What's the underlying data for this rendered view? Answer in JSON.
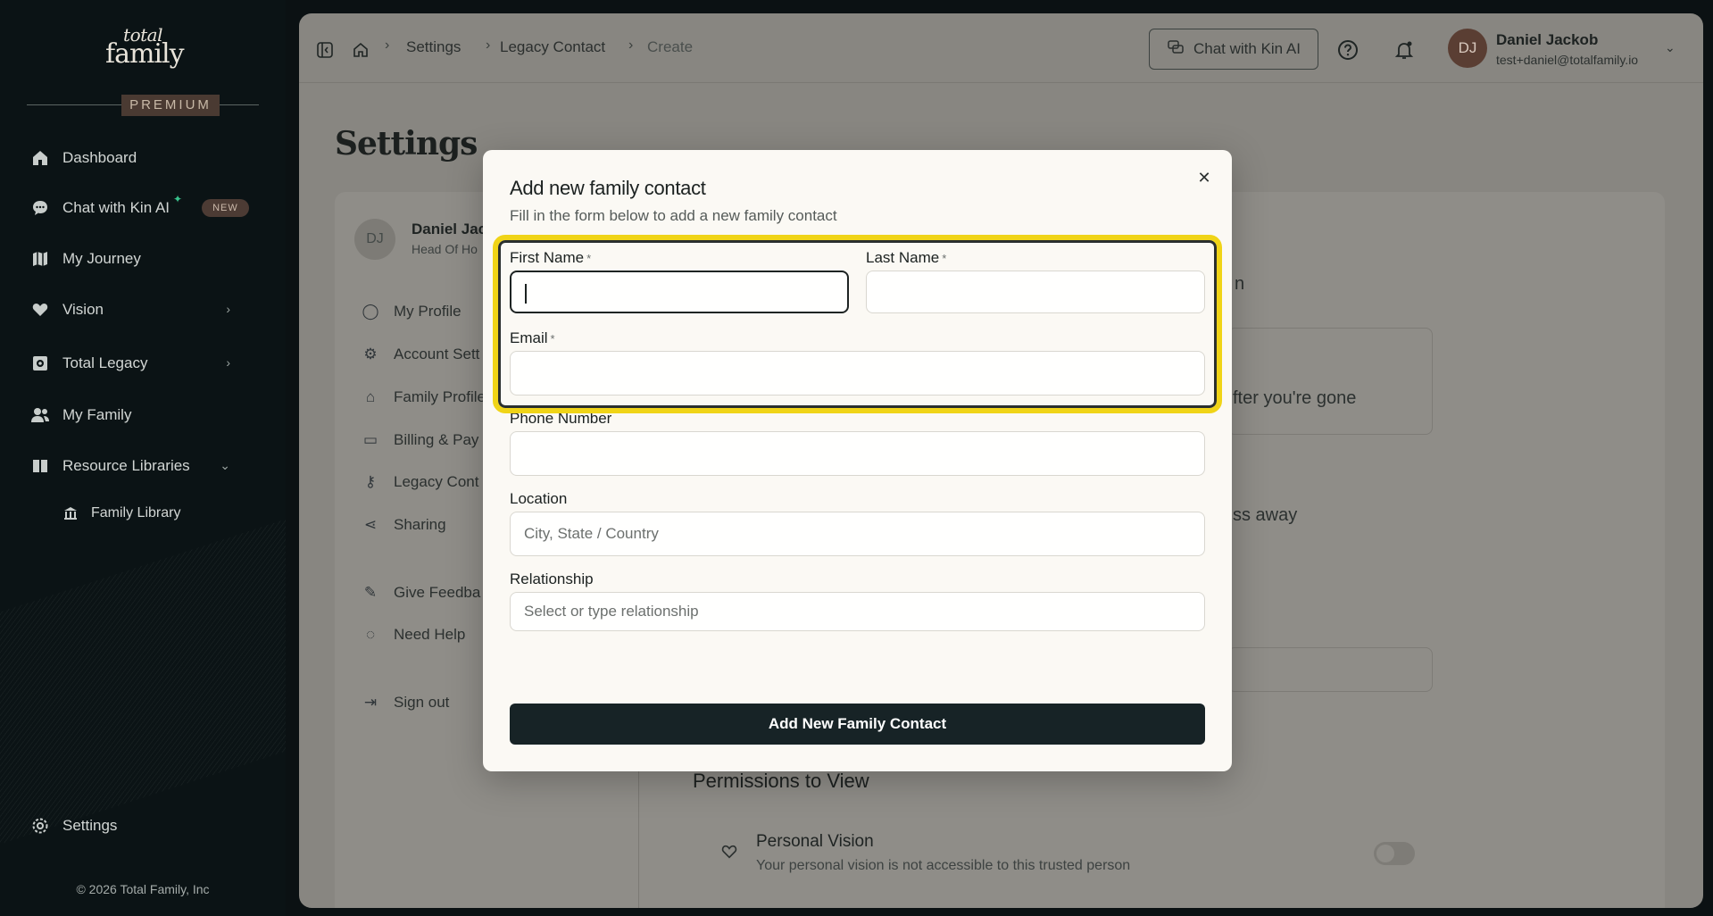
{
  "sidebar": {
    "logo_top": "total",
    "logo_bottom": "family",
    "tier": "PREMIUM",
    "items": [
      {
        "label": "Dashboard",
        "icon": "home-icon"
      },
      {
        "label": "Chat with Kin AI",
        "icon": "chat-icon",
        "badge": "NEW"
      },
      {
        "label": "My Journey",
        "icon": "map-icon"
      },
      {
        "label": "Vision",
        "icon": "heart-icon"
      },
      {
        "label": "Total Legacy",
        "icon": "vault-icon"
      },
      {
        "label": "My Family",
        "icon": "people-icon"
      },
      {
        "label": "Resource Libraries",
        "icon": "book-icon"
      },
      {
        "label": "Family Library",
        "icon": "library-icon"
      }
    ],
    "settings_label": "Settings",
    "copyright": "© 2026 Total Family, Inc"
  },
  "topbar": {
    "breadcrumbs": [
      "Settings",
      "Legacy Contact",
      "Create"
    ],
    "chat_button": "Chat with Kin AI",
    "user_initials": "DJ",
    "user_name": "Daniel Jackob",
    "user_email": "test+daniel@totalfamily.io"
  },
  "page": {
    "title": "Settings",
    "profile_initials": "DJ",
    "profile_name": "Daniel Jac",
    "profile_role": "Head Of Ho",
    "menu": [
      "My Profile",
      "Account Sett",
      "Family Profile",
      "Billing & Pay",
      "Legacy Cont",
      "Sharing",
      "Give Feedba",
      "Need Help",
      "Sign out"
    ],
    "bg_text_1": "fter you're gone",
    "bg_text_2": "ss away",
    "bg_text_3": "n",
    "permissions_title": "Permissions to View",
    "permission_name": "Personal Vision",
    "permission_desc": "Your personal vision is not accessible to this trusted person"
  },
  "modal": {
    "title": "Add new family contact",
    "subtitle": "Fill in the form below to add a new family contact",
    "first_name_label": "First Name",
    "last_name_label": "Last Name",
    "email_label": "Email",
    "phone_label": "Phone Number",
    "location_label": "Location",
    "location_placeholder": "City, State / Country",
    "relationship_label": "Relationship",
    "relationship_placeholder": "Select or type relationship",
    "required_mark": "*",
    "first_name_value": "",
    "last_name_value": "",
    "email_value": "",
    "phone_value": "",
    "submit_label": "Add New Family Contact"
  },
  "colors": {
    "highlight": "#f0d417",
    "button_bg": "#172326",
    "sidebar_bg": "#0b1315"
  }
}
